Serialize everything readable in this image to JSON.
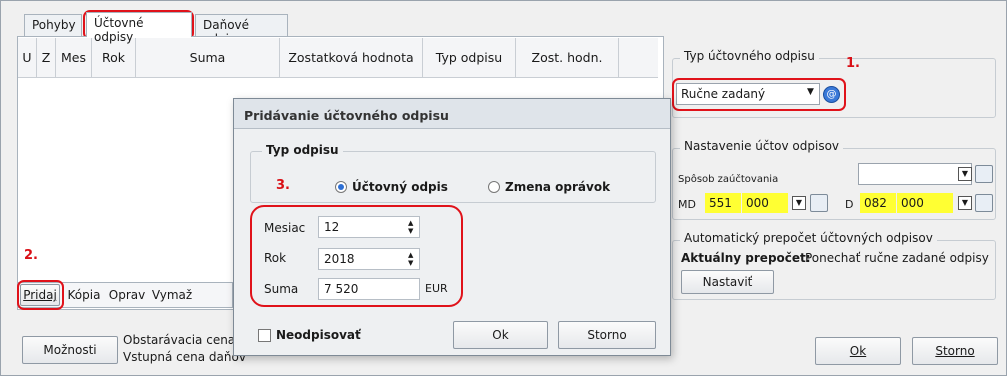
{
  "tabs": [
    {
      "label": "Pohyby"
    },
    {
      "label": "Účtovné odpisy"
    },
    {
      "label": "Daňové odpisy"
    }
  ],
  "grid": {
    "columns": [
      "U",
      "Z",
      "Mes",
      "Rok",
      "Suma",
      "Zostatková hodnota",
      "Typ odpisu",
      "Zost. hodn."
    ]
  },
  "grid_buttons": {
    "add": "Pridaj",
    "copy": "Kópia",
    "edit": "Oprav",
    "delete": "Vymaž"
  },
  "bottom": {
    "options_button": "Možnosti",
    "info1": "Obstarávacia cena",
    "info2": "Vstupná cena daňov",
    "ok": "Ok",
    "cancel": "Storno"
  },
  "right_panel": {
    "type_group": {
      "title": "Typ účtovného odpisu",
      "selected": "Ručne zadaný"
    },
    "accounts_group": {
      "title": "Nastavenie účtov odpisov",
      "method_label": "Spôsob zaúčtovania",
      "method_value": "",
      "md_label": "MD",
      "md_account": "551",
      "md_analytic": "000",
      "d_label": "D",
      "d_account": "082",
      "d_analytic": "000"
    },
    "auto_group": {
      "title": "Automatický prepočet účtovných odpisov",
      "current_label": "Aktuálny prepočet:",
      "current_value": "Ponechať ručne zadané odpisy",
      "set_button": "Nastaviť"
    }
  },
  "dialog": {
    "title": "Pridávanie účtovného odpisu",
    "type_group_title": "Typ odpisu",
    "radio_accounting": "Účtovný odpis",
    "radio_change": "Zmena oprávok",
    "month_label": "Mesiac",
    "month_value": "12",
    "year_label": "Rok",
    "year_value": "2018",
    "amount_label": "Suma",
    "amount_value": "7 520",
    "currency": "EUR",
    "no_depreciate": "Neodpisovať",
    "ok": "Ok",
    "cancel": "Storno"
  },
  "annotations": [
    "1.",
    "2.",
    "3."
  ],
  "colors": {
    "highlight_red": "#e0121a",
    "field_yellow": "#ffff33"
  }
}
